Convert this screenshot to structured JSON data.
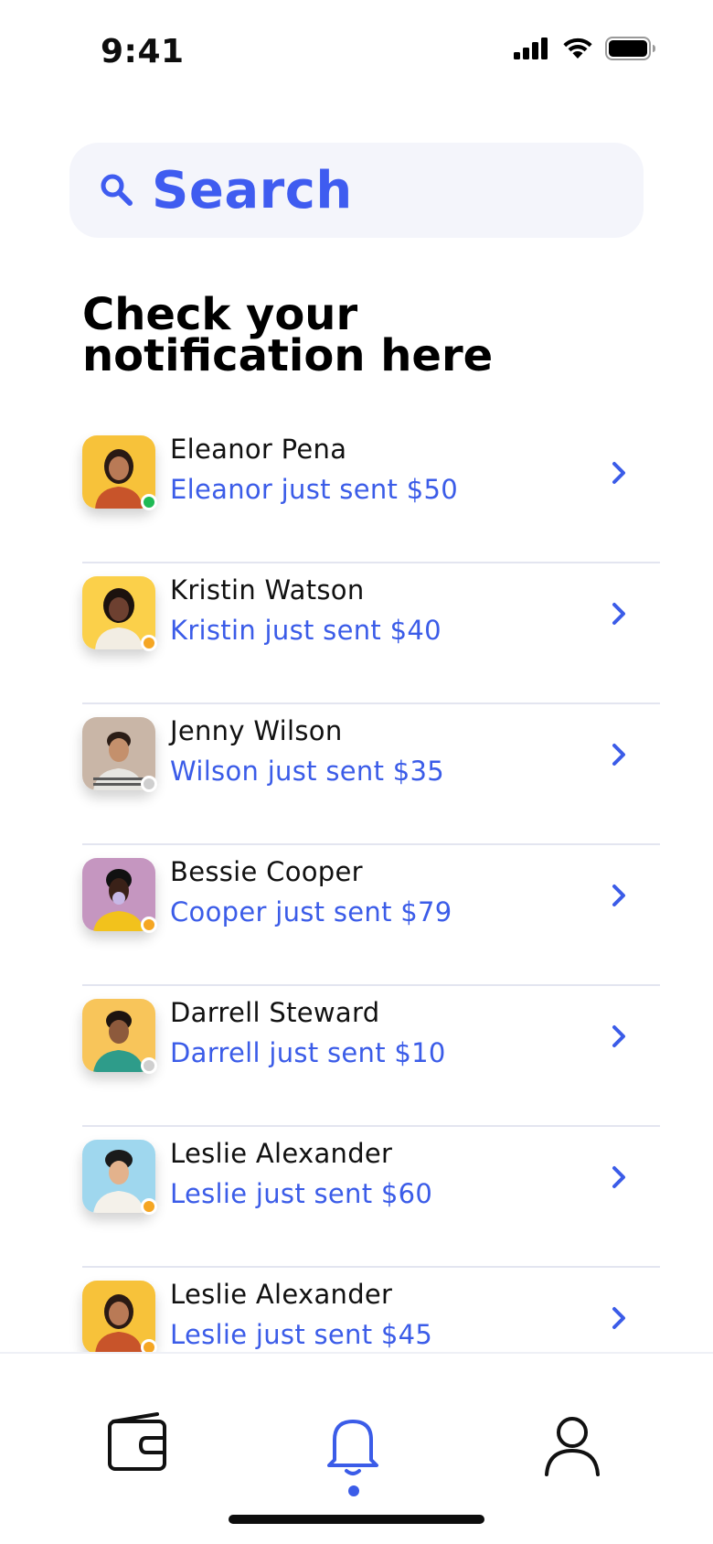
{
  "status_bar": {
    "time": "9:41"
  },
  "search": {
    "label": "Search"
  },
  "page": {
    "title": "Check your notification here"
  },
  "colors": {
    "accent": "#3f5cf0",
    "online": "#1fba55",
    "away": "#f5a623",
    "offline": "#cfcfcf"
  },
  "notifications": [
    {
      "name": "Eleanor Pena",
      "message": "Eleanor just sent $50",
      "status": "online",
      "avatar_bg": "#f7c23a"
    },
    {
      "name": "Kristin Watson",
      "message": "Kristin just sent $40",
      "status": "away",
      "avatar_bg": "#fbd04a"
    },
    {
      "name": "Jenny Wilson",
      "message": "Wilson just sent $35",
      "status": "offline",
      "avatar_bg": "#c9b6a7"
    },
    {
      "name": "Bessie Cooper",
      "message": "Cooper just sent $79",
      "status": "away",
      "avatar_bg": "#c596c0"
    },
    {
      "name": "Darrell Steward",
      "message": "Darrell just sent $10",
      "status": "offline",
      "avatar_bg": "#f8c55a"
    },
    {
      "name": "Leslie Alexander",
      "message": "Leslie just sent $60",
      "status": "away",
      "avatar_bg": "#9fd7ee"
    },
    {
      "name": "Leslie Alexander",
      "message": "Leslie just sent $45",
      "status": "away",
      "avatar_bg": "#f7c23a"
    }
  ],
  "tabs": [
    {
      "icon": "wallet-icon",
      "active": false
    },
    {
      "icon": "bell-icon",
      "active": true
    },
    {
      "icon": "user-icon",
      "active": false
    }
  ]
}
